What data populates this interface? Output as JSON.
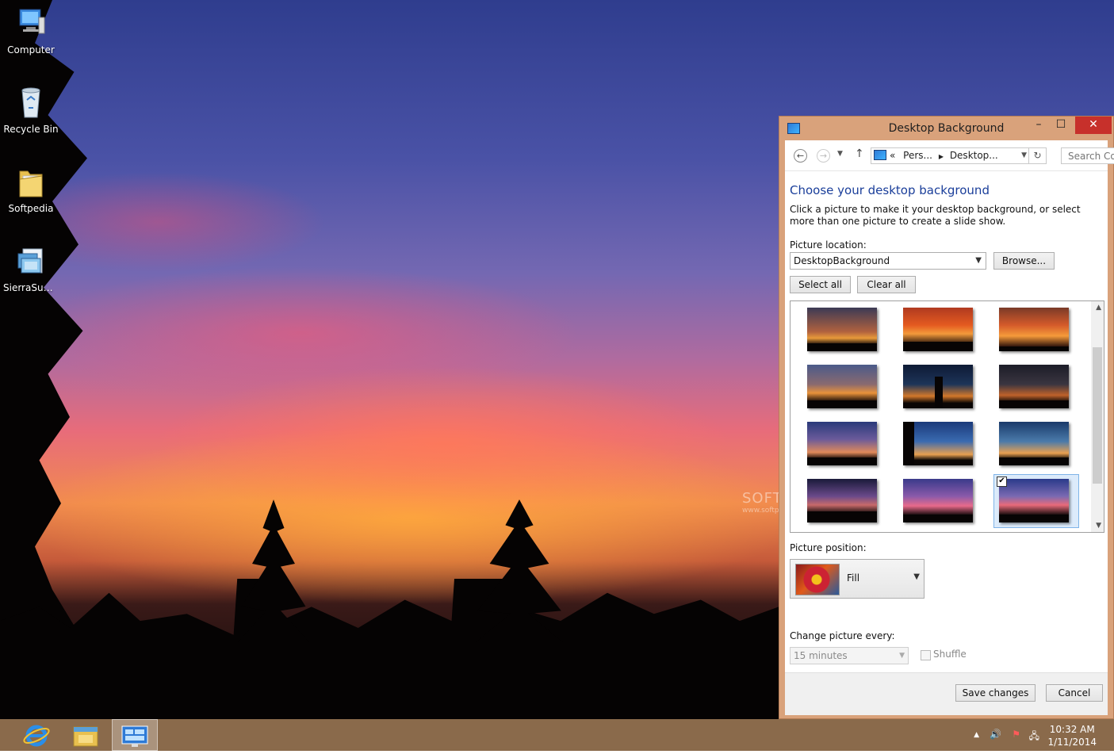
{
  "desktop": {
    "icons": [
      {
        "label": "Computer",
        "icon": "computer-icon"
      },
      {
        "label": "Recycle Bin",
        "icon": "recycle-bin-icon"
      },
      {
        "label": "Softpedia",
        "icon": "folder-icon"
      },
      {
        "label": "SierraSunse...",
        "icon": "theme-file-icon"
      }
    ],
    "watermark": {
      "main": "SOFTPEDIA",
      "sub": "www.softpedia.com"
    }
  },
  "window": {
    "title": "Desktop Background",
    "controls": {
      "minimize": "–",
      "maximize": "☐",
      "close": "✕"
    },
    "nav": {
      "back": "←",
      "forward": "→",
      "up": "↑",
      "address_prefix": "«",
      "address_crumbs": [
        "Pers...",
        "Desktop..."
      ],
      "search_placeholder": "Search Co"
    },
    "heading": "Choose your desktop background",
    "description": "Click a picture to make it your desktop background, or select more than one picture to create a slide show.",
    "picture_location_label": "Picture location:",
    "picture_location_value": "DesktopBackground",
    "browse_label": "Browse...",
    "select_all_label": "Select all",
    "clear_all_label": "Clear all",
    "thumbnails": [
      {
        "selected": false
      },
      {
        "selected": false
      },
      {
        "selected": false
      },
      {
        "selected": false
      },
      {
        "selected": false
      },
      {
        "selected": false
      },
      {
        "selected": false
      },
      {
        "selected": false
      },
      {
        "selected": false
      },
      {
        "selected": false
      },
      {
        "selected": false
      },
      {
        "selected": true
      }
    ],
    "picture_position_label": "Picture position:",
    "picture_position_value": "Fill",
    "change_picture_label": "Change picture every:",
    "change_picture_value": "15 minutes",
    "shuffle_label": "Shuffle",
    "shuffle_checked": false,
    "save_label": "Save changes",
    "cancel_label": "Cancel"
  },
  "taskbar": {
    "apps": [
      "internet-explorer-icon",
      "file-explorer-icon",
      "personalization-icon"
    ],
    "clock_time": "10:32 AM",
    "clock_date": "1/11/2014"
  },
  "colors": {
    "taskbar": "#8a6a4b",
    "window_frame": "#d9a27b",
    "heading": "#1a3e9a",
    "close_button": "#c7302b"
  }
}
